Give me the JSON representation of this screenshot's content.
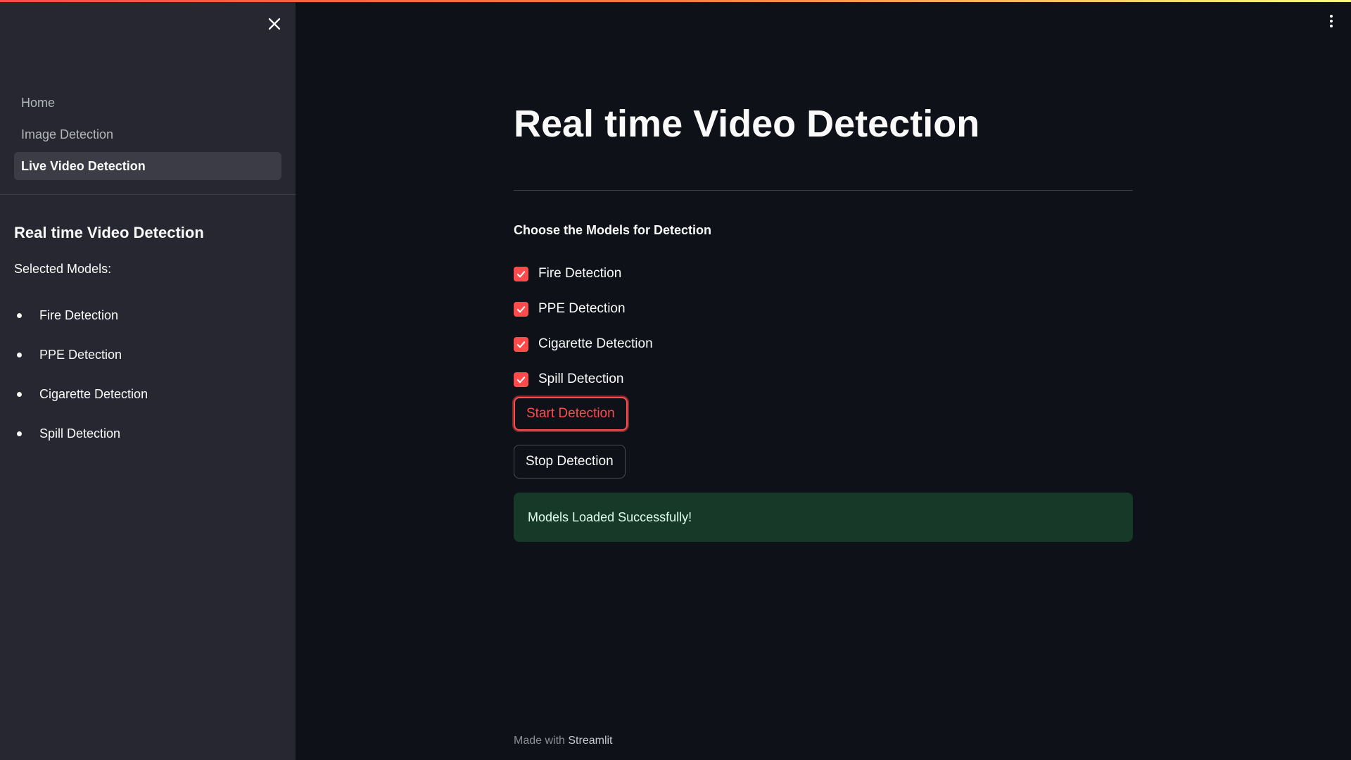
{
  "sidebar": {
    "nav": [
      {
        "label": "Home",
        "active": false
      },
      {
        "label": "Image Detection",
        "active": false
      },
      {
        "label": "Live Video Detection",
        "active": true
      }
    ],
    "title": "Real time Video Detection",
    "subtitle": "Selected Models:",
    "selected_models": [
      "Fire Detection",
      "PPE Detection",
      "Cigarette Detection",
      "Spill Detection"
    ]
  },
  "main": {
    "title": "Real time Video Detection",
    "section_label": "Choose the Models for Detection",
    "checkboxes": [
      {
        "label": "Fire Detection",
        "checked": true
      },
      {
        "label": "PPE Detection",
        "checked": true
      },
      {
        "label": "Cigarette Detection",
        "checked": true
      },
      {
        "label": "Spill Detection",
        "checked": true
      }
    ],
    "start_button": "Start Detection",
    "stop_button": "Stop Detection",
    "success_message": "Models Loaded Successfully!"
  },
  "footer": {
    "prefix": "Made with",
    "brand": "Streamlit"
  },
  "icons": {
    "close": "close-icon",
    "menu": "vertical-ellipsis-icon",
    "check": "checkmark-icon"
  },
  "colors": {
    "accent": "#ff4b4b",
    "background": "#0e1117",
    "sidebar": "#262730",
    "success_bg": "#173928"
  }
}
